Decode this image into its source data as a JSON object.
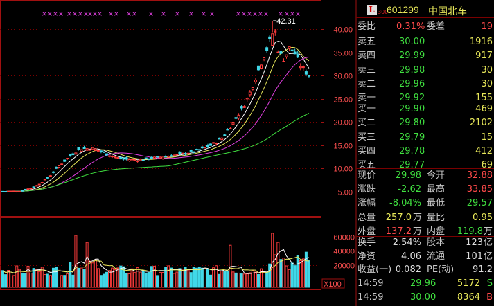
{
  "chart": {
    "price_ticks": [
      "40.00",
      "35.00",
      "30.00",
      "25.00",
      "20.00",
      "15.00",
      "10.00",
      "5.00"
    ],
    "volume_ticks": [
      "60000",
      "40000",
      "20000"
    ],
    "unit_label": "X100",
    "peak_label": "42.31",
    "colors": {
      "up": "#ff3c3c",
      "down": "#40d8e8",
      "ma5": "#ffffff",
      "ma10": "#e8e85a",
      "ma20": "#e040e0",
      "ma60": "#40e040",
      "grid": "#7a0000",
      "axis": "#a01010",
      "marker": "#e040e0"
    }
  },
  "quote": {
    "logo": "L",
    "logo_sub": "300",
    "code": "601299",
    "name": "中国北车",
    "webi_label": "委比",
    "webi_value": "0.31%",
    "wecha_label": "委差",
    "wecha_value": "19",
    "asks": [
      {
        "label": "卖五",
        "price": "30.00",
        "vol": "1916"
      },
      {
        "label": "卖四",
        "price": "29.99",
        "vol": "917"
      },
      {
        "label": "卖三",
        "price": "29.98",
        "vol": "30"
      },
      {
        "label": "卖二",
        "price": "29.96",
        "vol": "30"
      },
      {
        "label": "卖一",
        "price": "29.92",
        "vol": "155"
      }
    ],
    "bids": [
      {
        "label": "买一",
        "price": "29.90",
        "vol": "469"
      },
      {
        "label": "买二",
        "price": "29.80",
        "vol": "2102"
      },
      {
        "label": "买三",
        "price": "29.79",
        "vol": "15"
      },
      {
        "label": "买四",
        "price": "29.78",
        "vol": "412"
      },
      {
        "label": "买五",
        "price": "29.77",
        "vol": "69"
      }
    ],
    "stats": [
      {
        "l1": "现价",
        "v1": "29.98",
        "l2": "今开",
        "v2": "32.88"
      },
      {
        "l1": "涨跌",
        "v1": "-2.62",
        "l2": "最高",
        "v2": "33.85"
      },
      {
        "l1": "涨幅",
        "v1": "-8.04%",
        "l2": "最低",
        "v2": "29.57"
      },
      {
        "l1": "总量",
        "v1": "257.0",
        "u1": "万",
        "l2": "量比",
        "v2": "0.95"
      },
      {
        "l1": "外盘",
        "v1": "137.2",
        "u1": "万",
        "l2": "内盘",
        "v2": "119.8",
        "u2": "万"
      }
    ],
    "stats2": [
      {
        "l1": "换手",
        "v1": "2.54%",
        "l2": "股本",
        "v2": "123",
        "u2": "亿"
      },
      {
        "l1": "净资",
        "v1": "4.06",
        "l2": "流通",
        "v2": "101",
        "u2": "亿"
      },
      {
        "l1": "收益(一)",
        "v1": "0.082",
        "l2": "PE(动)",
        "v2": "91.2"
      }
    ],
    "ticks": [
      {
        "time": "14:59",
        "price": "29.96",
        "vol": "5172",
        "side": "S"
      },
      {
        "time": "14:59",
        "price": "30.00",
        "vol": "8364",
        "side": "B"
      }
    ]
  }
}
